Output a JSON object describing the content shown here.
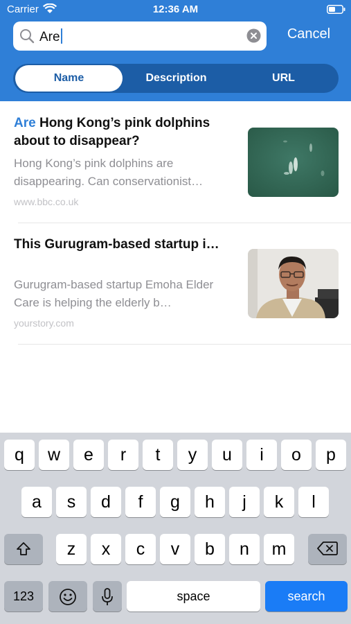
{
  "status_bar": {
    "carrier": "Carrier",
    "time": "12:36 AM"
  },
  "search": {
    "query": "Are",
    "cancel_label": "Cancel"
  },
  "scopes": {
    "active": "Name",
    "items": [
      "Name",
      "Description",
      "URL"
    ]
  },
  "results": [
    {
      "title_highlight": "Are",
      "title_rest": " Hong Kong’s pink dolphins about to disappear?",
      "description": "Hong Kong’s pink dolphins are disappearing. Can conservationist…",
      "url": "www.bbc.co.uk",
      "thumbnail": "dolphins-in-water"
    },
    {
      "title_highlight": "",
      "title_rest": "This Gurugram-based startup i…",
      "description": "Gurugram-based startup Emoha Elder Care is helping the elderly b…",
      "url": "yourstory.com",
      "thumbnail": "man-portrait"
    }
  ],
  "keyboard": {
    "row1": [
      "q",
      "w",
      "e",
      "r",
      "t",
      "y",
      "u",
      "i",
      "o",
      "p"
    ],
    "row2": [
      "a",
      "s",
      "d",
      "f",
      "g",
      "h",
      "j",
      "k",
      "l"
    ],
    "row3": [
      "z",
      "x",
      "c",
      "v",
      "b",
      "n",
      "m"
    ],
    "numbers_label": "123",
    "space_label": "space",
    "search_label": "search",
    "icons": {
      "shift": "shift-icon",
      "delete": "delete-icon",
      "emoji": "emoji-icon",
      "mic": "microphone-icon"
    }
  },
  "colors": {
    "header": "#2f7fd7",
    "segment_bg": "#1c5da6",
    "highlight": "#2f7fd7",
    "search_key": "#1a7cf6"
  }
}
